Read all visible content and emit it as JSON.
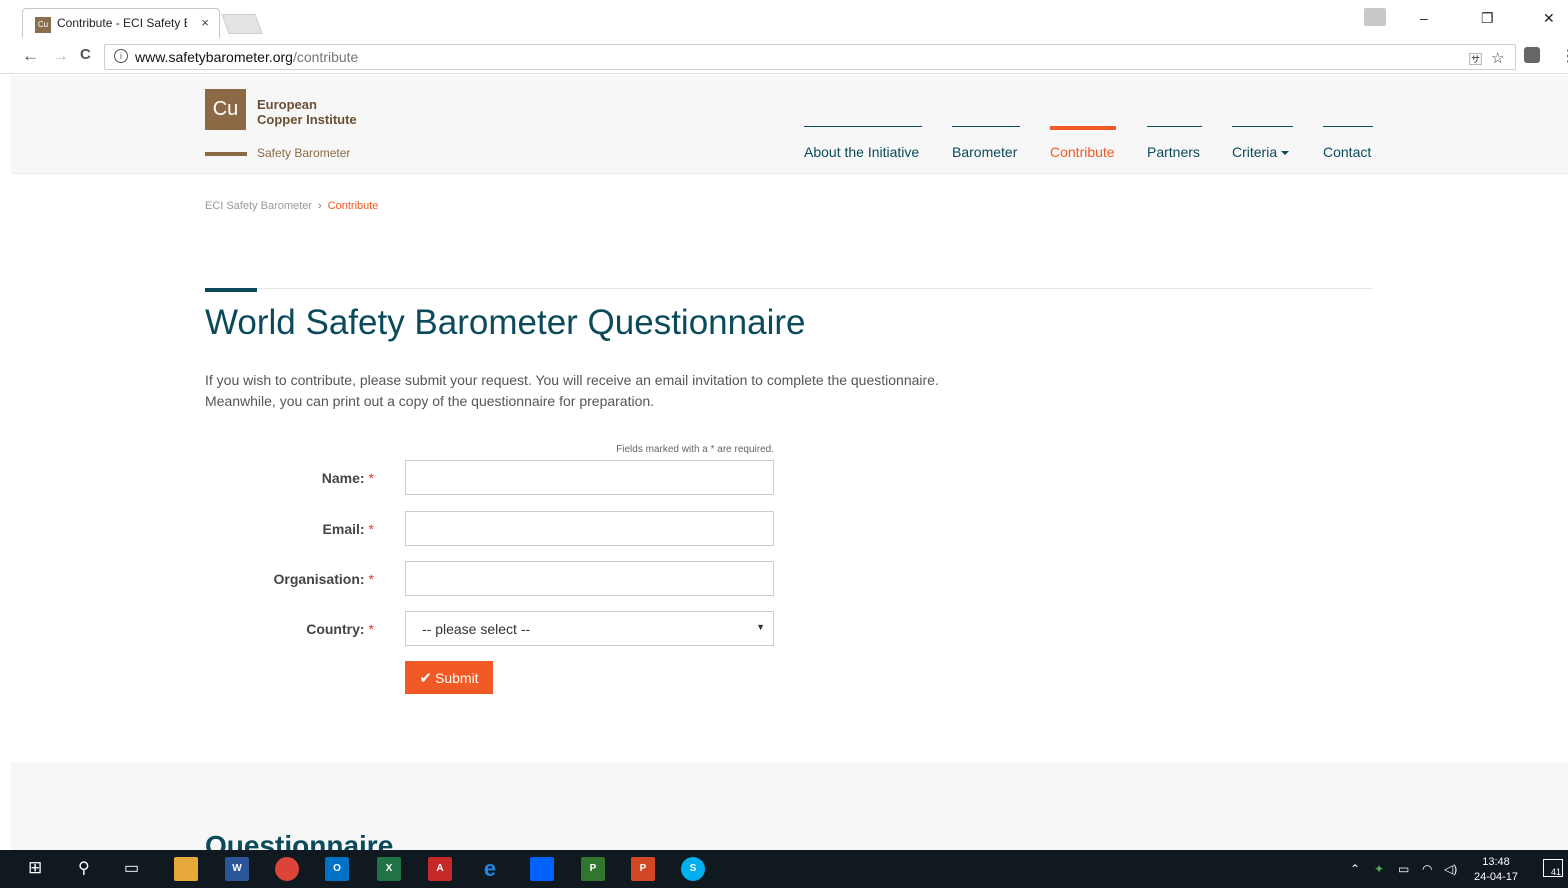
{
  "browser": {
    "tab_title": "Contribute - ECI Safety B",
    "tab_favicon": "Cu",
    "tab_close": "×",
    "url_host": "www.safetybarometer.org",
    "url_path": "/contribute",
    "back": "←",
    "forward": "→",
    "reload": "C",
    "translate_icon": "translate-icon",
    "bookmark": "☆",
    "menu": "⋮",
    "minimize": "–",
    "restore": "❐",
    "close": "✕"
  },
  "site": {
    "logo_mark": "Cu",
    "logo_line1": "European",
    "logo_line2": "Copper Institute",
    "logo_sub": "Safety Barometer",
    "nav": [
      {
        "label": "About the Initiative"
      },
      {
        "label": "Barometer"
      },
      {
        "label": "Contribute"
      },
      {
        "label": "Partners"
      },
      {
        "label": "Criteria"
      },
      {
        "label": "Contact"
      }
    ]
  },
  "breadcrumb": {
    "home": "ECI Safety Barometer",
    "separator": "›",
    "current": "Contribute"
  },
  "main": {
    "title": "World Safety Barometer Questionnaire",
    "intro_line1": "If you wish to contribute, please submit your request. You will receive an email invitation to complete the questionnaire.",
    "intro_line2": "Meanwhile, you can print out a copy of the questionnaire for preparation."
  },
  "form": {
    "required_note": "Fields marked with a * are required.",
    "star": "*",
    "name_label": "Name:",
    "email_label": "Email:",
    "organisation_label": "Organisation:",
    "country_label": "Country:",
    "country_selected": "-- please select --",
    "submit_label": "Submit"
  },
  "footer": {
    "heading": "Questionnaire"
  },
  "taskbar": {
    "time": "13:48",
    "date": "24-04-17",
    "notifications": "41"
  },
  "colors": {
    "accent": "#f15a24",
    "brand_teal": "#0b4a5b",
    "logo_brown": "#8c6a45"
  }
}
